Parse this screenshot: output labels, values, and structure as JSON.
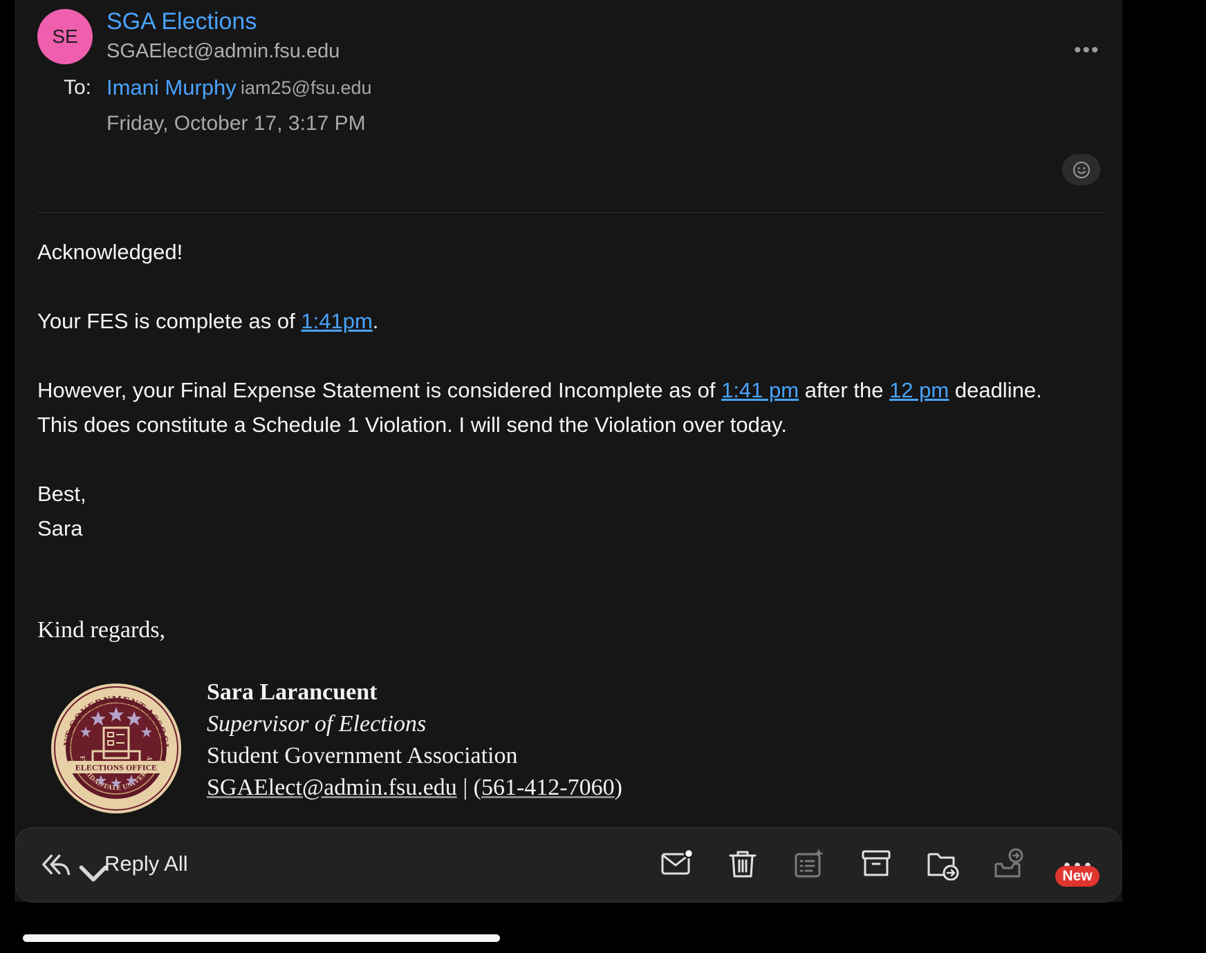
{
  "sender": {
    "initials": "SE",
    "name": "SGA Elections",
    "email": "SGAElect@admin.fsu.edu"
  },
  "recipient": {
    "label": "To:",
    "name": "Imani Murphy",
    "email": "iam25@fsu.edu"
  },
  "date": "Friday, October 17, 3:17 PM",
  "body": {
    "greeting": "Acknowledged!",
    "p1_pre": "Your FES is complete as of ",
    "p1_link": "1:41pm",
    "p1_post": ".",
    "p2_pre": "However, your Final Expense Statement is considered Incomplete as of ",
    "p2_link1": "1:41 pm",
    "p2_mid": " after the ",
    "p2_link2": "12 pm",
    "p2_post": " deadline.",
    "p2_line2": "This does constitute a Schedule 1 Violation. I will send the Violation over today.",
    "closing": "Best,",
    "signoff_name": "Sara",
    "kind_regards": "Kind regards,"
  },
  "signature": {
    "name": "Sara Larancuent",
    "title": "Supervisor of Elections",
    "org": "Student Government Association",
    "email": "SGAElect@admin.fsu.edu",
    "separator": " | (",
    "phone": "561-412-7060",
    "close_paren": ")",
    "seal_text_top": "STUDENT GOVERNMENT ASSOCIATION",
    "seal_text_bottom": "FLORIDA STATE UNIVERSITY",
    "seal_banner": "ELECTIONS OFFICE"
  },
  "toolbar": {
    "reply_all_label": "Reply All",
    "new_badge": "New",
    "icons": [
      "reply-all-icon",
      "chevron-down-icon",
      "mark-unread-icon",
      "trash-icon",
      "summarize-icon",
      "archive-icon",
      "move-folder-icon",
      "report-icon",
      "more-icon"
    ]
  },
  "colors": {
    "accent": "#4aa3ff",
    "avatar": "#ef5fae",
    "badge": "#e0342f",
    "background": "#161616"
  }
}
